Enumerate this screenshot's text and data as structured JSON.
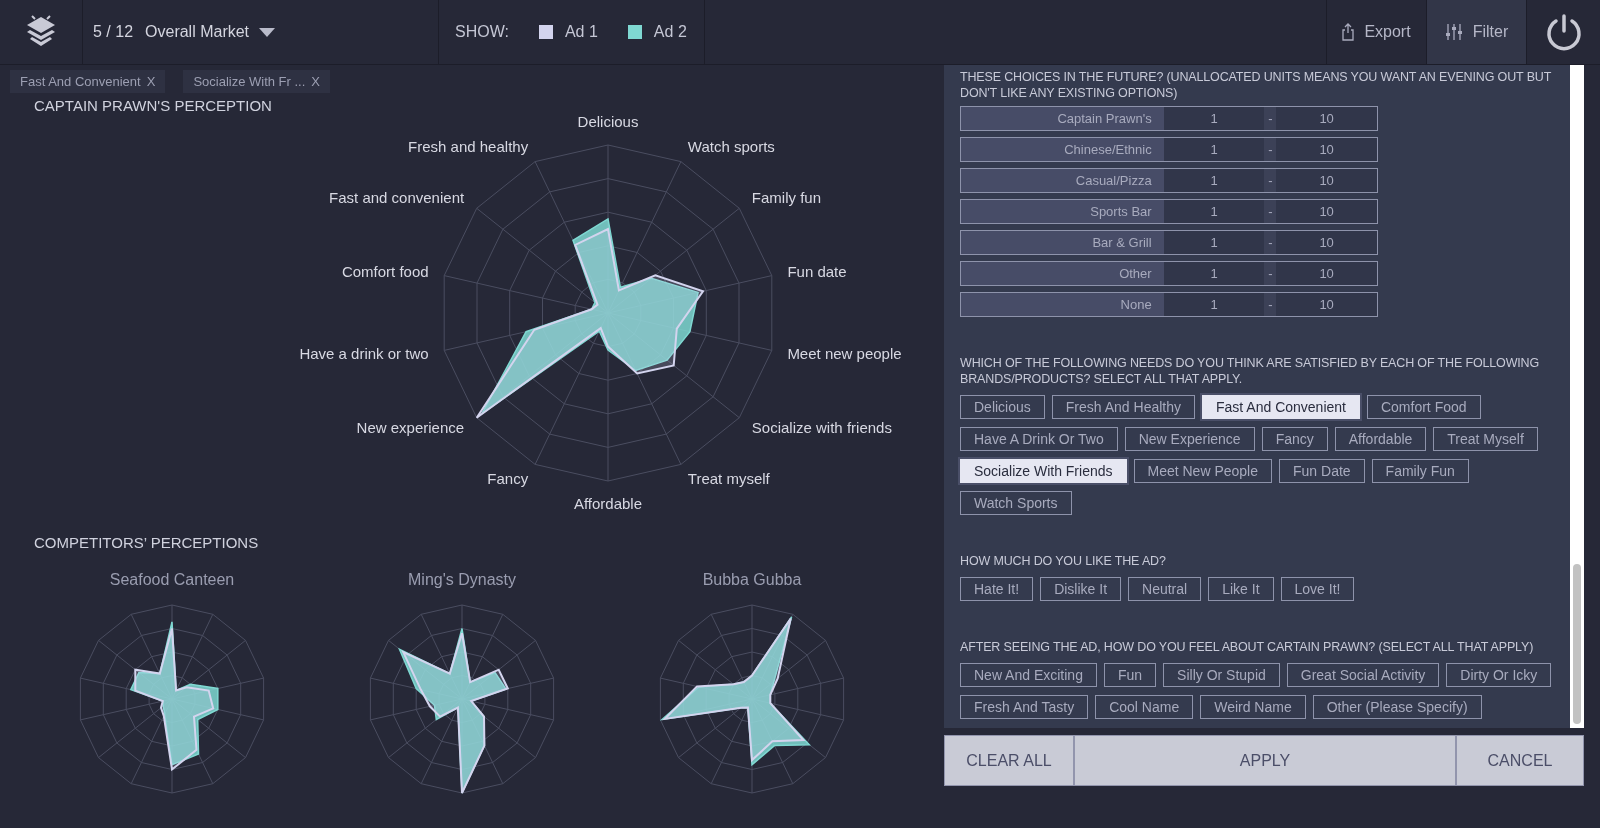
{
  "header": {
    "page": "5 / 12",
    "segment": "Overall Market",
    "show_label": "SHOW:",
    "legend": [
      {
        "label": "Ad 1",
        "color": "#d3d4ee"
      },
      {
        "label": "Ad 2",
        "color": "#7fd8d2"
      }
    ],
    "actions": [
      {
        "label": "Export",
        "kind": "export",
        "selected": false
      },
      {
        "label": "Filter",
        "kind": "filter",
        "selected": true
      }
    ]
  },
  "filter_tags": [
    {
      "label": "Fast And Convenient",
      "close": "X"
    },
    {
      "label": "Socialize With Fr ...",
      "close": "X"
    }
  ],
  "main_chart": {
    "title": "CAPTAIN PRAWN'S PERCEPTION",
    "axes": [
      "Delicious",
      "Fresh and healthy",
      "Watch sports",
      "Fast and convenient",
      "Family fun",
      "Comfort food",
      "Fun date",
      "Have a drink or two",
      "Meet new people",
      "New experience",
      "Socialize with friends",
      "Fancy",
      "Treat myself",
      "Affordable"
    ]
  },
  "competitors": {
    "title": "COMPETITORS’ PERCEPTIONS",
    "charts": [
      {
        "name": "Seafood Canteen"
      },
      {
        "name": "Ming's Dynasty"
      },
      {
        "name": "Bubba Gubba"
      }
    ]
  },
  "filter_panel": {
    "range_question": "THESE CHOICES IN THE FUTURE? (UNALLOCATED UNITS MEANS YOU WANT AN EVENING OUT BUT DON'T LIKE ANY EXISTING OPTIONS)",
    "ranges": [
      {
        "label": "Captain Prawn's",
        "min": "1",
        "separator": "-",
        "max": "10"
      },
      {
        "label": "Chinese/Ethnic",
        "min": "1",
        "separator": "-",
        "max": "10"
      },
      {
        "label": "Casual/Pizza",
        "min": "1",
        "separator": "-",
        "max": "10"
      },
      {
        "label": "Sports Bar",
        "min": "1",
        "separator": "-",
        "max": "10"
      },
      {
        "label": "Bar & Grill",
        "min": "1",
        "separator": "-",
        "max": "10"
      },
      {
        "label": "Other",
        "min": "1",
        "separator": "-",
        "max": "10"
      },
      {
        "label": "None",
        "min": "1",
        "separator": "-",
        "max": "10"
      }
    ],
    "questions": [
      {
        "text": "WHICH OF THE FOLLOWING NEEDS DO YOU THINK ARE SATISFIED BY EACH OF THE FOLLOWING BRANDS/PRODUCTS? SELECT ALL THAT APPLY.",
        "options": [
          {
            "label": "Delicious",
            "selected": false
          },
          {
            "label": "Fresh And Healthy",
            "selected": false
          },
          {
            "label": "Fast And Convenient",
            "selected": true
          },
          {
            "label": "Comfort Food",
            "selected": false
          },
          {
            "label": "Have A Drink Or Two",
            "selected": false
          },
          {
            "label": "New Experience",
            "selected": false
          },
          {
            "label": "Fancy",
            "selected": false
          },
          {
            "label": "Affordable",
            "selected": false
          },
          {
            "label": "Treat Myself",
            "selected": false
          },
          {
            "label": "Socialize With Friends",
            "selected": true
          },
          {
            "label": "Meet New People",
            "selected": false
          },
          {
            "label": "Fun Date",
            "selected": false
          },
          {
            "label": "Family Fun",
            "selected": false
          },
          {
            "label": "Watch Sports",
            "selected": false
          }
        ]
      },
      {
        "text": "HOW MUCH DO YOU LIKE THE AD?",
        "options": [
          {
            "label": "Hate It!",
            "selected": false
          },
          {
            "label": "Dislike It",
            "selected": false
          },
          {
            "label": "Neutral",
            "selected": false
          },
          {
            "label": "Like It",
            "selected": false
          },
          {
            "label": "Love It!",
            "selected": false
          }
        ]
      },
      {
        "text": "AFTER SEEING THE AD, HOW DO YOU FEEL ABOUT CARTAIN PRAWN? (SELECT ALL THAT APPLY)",
        "options": [
          {
            "label": "New And Exciting",
            "selected": false
          },
          {
            "label": "Fun",
            "selected": false
          },
          {
            "label": "Silly Or Stupid",
            "selected": false
          },
          {
            "label": "Great Social Activity",
            "selected": false
          },
          {
            "label": "Dirty Or Icky",
            "selected": false
          },
          {
            "label": "Fresh And Tasty",
            "selected": false
          },
          {
            "label": "Cool Name",
            "selected": false
          },
          {
            "label": "Weird Name",
            "selected": false
          },
          {
            "label": "Other (Please Specify)",
            "selected": false
          }
        ]
      }
    ],
    "buttons": [
      {
        "label": "CLEAR ALL"
      },
      {
        "label": "APPLY"
      },
      {
        "label": "CANCEL"
      }
    ]
  }
}
